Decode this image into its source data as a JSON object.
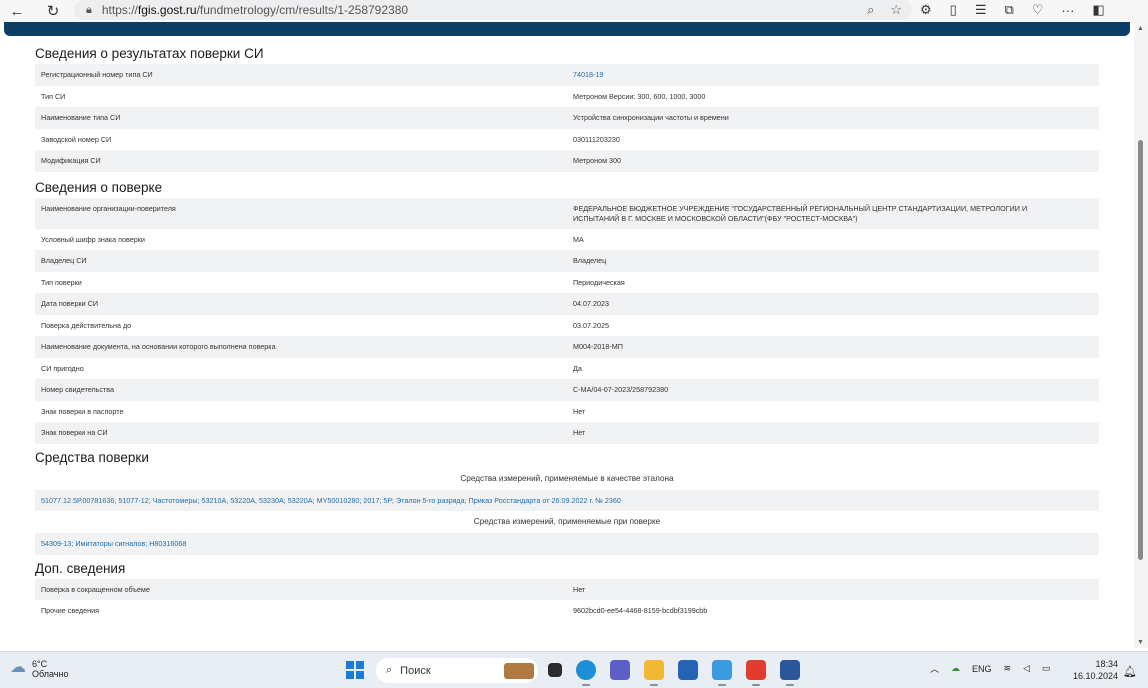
{
  "browser": {
    "url_prefix": "https://",
    "url_host": "fgis.gost.ru",
    "url_path": "/fundmetrology/cm/results/1-258792380"
  },
  "sections": {
    "results_title": "Сведения о результатах поверки СИ",
    "results_rows": [
      {
        "key": "Регистрационный номер типа СИ",
        "value": "74018-19",
        "link": true
      },
      {
        "key": "Тип СИ",
        "value": "Метроном Версии: 300, 600, 1000, 3000"
      },
      {
        "key": "Наименование типа СИ",
        "value": "Устройства синхронизации частоты и времени"
      },
      {
        "key": "Заводской номер СИ",
        "value": "030111203230"
      },
      {
        "key": "Модификация СИ",
        "value": "Метроном 300"
      }
    ],
    "verification_title": "Сведения о поверке",
    "verification_org_key": "Наименование организации-поверителя",
    "verification_org_value": "ФЕДЕРАЛЬНОЕ БЮДЖЕТНОЕ УЧРЕЖДЕНИЕ \"ГОСУДАРСТВЕННЫЙ РЕГИОНАЛЬНЫЙ ЦЕНТР СТАНДАРТИЗАЦИИ, МЕТРОЛОГИИ И ИСПЫТАНИЙ В Г. МОСКВЕ И МОСКОВСКОЙ ОБЛАСТИ\"(ФБУ \"РОСТЕСТ-МОСКВА\")",
    "verification_rows": [
      {
        "key": "Условный шифр знака поверки",
        "value": "МА"
      },
      {
        "key": "Владелец СИ",
        "value": "Владелец"
      },
      {
        "key": "Тип поверки",
        "value": "Периодическая"
      },
      {
        "key": "Дата поверки СИ",
        "value": "04.07.2023"
      },
      {
        "key": "Поверка действительна до",
        "value": "03.07.2025"
      },
      {
        "key": "Наименование документа, на основании которого выполнена поверка",
        "value": "М004-2018-МП"
      },
      {
        "key": "СИ пригодно",
        "value": "Да"
      },
      {
        "key": "Номер свидетельства",
        "value": "С-МА/04-07-2023/258792380"
      },
      {
        "key": "Знак поверки в паспорте",
        "value": "Нет"
      },
      {
        "key": "Знак поверки на СИ",
        "value": "Нет"
      }
    ],
    "means_title": "Средства поверки",
    "standards_subtitle": "Средства измерений, применяемые в качестве эталона",
    "standards_link": "51077.12.5Р.00781636; 51077-12; Частотомеры; 53210А, 53220А, 53230А; 53220А; MY50010280; 2017; 5Р; Эталон 5-го разряда; Приказ Росстандарта от 26.09.2022 г. № 2360",
    "instruments_subtitle": "Средства измерений, применяемые при поверке",
    "instruments_link": "54309-13; Имитаторы сигналов; Н80316068",
    "extra_title": "Доп. сведения",
    "extra_rows": [
      {
        "key": "Поверка в сокращенном объеме",
        "value": "Нет"
      },
      {
        "key": "Прочие сведения",
        "value": "9602bcd0-ee54-4468-8159-bcdbf3199cbb"
      }
    ]
  },
  "taskbar": {
    "temperature": "6°C",
    "weather": "Облачно",
    "search_placeholder": "Поиск",
    "lang": "ENG",
    "time": "18:34",
    "date": "16.10.2024"
  }
}
